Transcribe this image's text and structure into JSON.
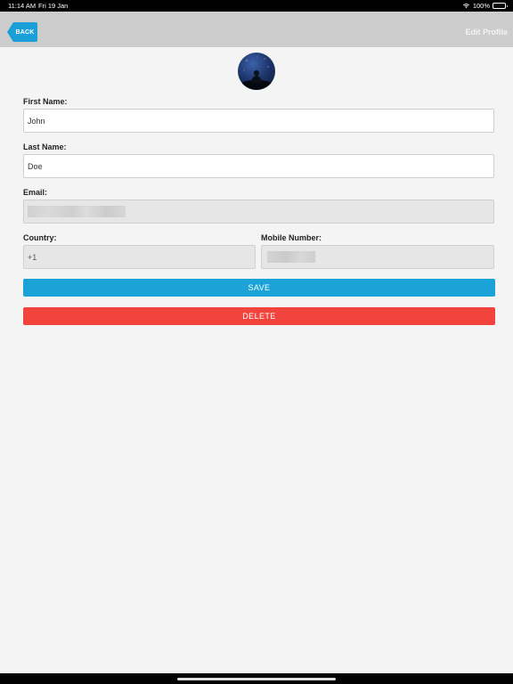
{
  "status_bar": {
    "time": "11:14 AM",
    "date": "Fri 19 Jan",
    "battery": "100%"
  },
  "nav": {
    "back_label": "BACK",
    "title": "Edit Profile"
  },
  "form": {
    "first_name": {
      "label": "First Name:",
      "value": "John"
    },
    "last_name": {
      "label": "Last Name:",
      "value": "Doe"
    },
    "email": {
      "label": "Email:",
      "value": ""
    },
    "country": {
      "label": "Country:",
      "value": "+1"
    },
    "mobile": {
      "label": "Mobile Number:",
      "value": ""
    }
  },
  "actions": {
    "save_label": "SAVE",
    "delete_label": "DELETE"
  },
  "colors": {
    "accent": "#1ba3d8",
    "danger": "#f2443d",
    "nav_bg": "#cccccc",
    "page_bg": "#f4f4f4"
  }
}
